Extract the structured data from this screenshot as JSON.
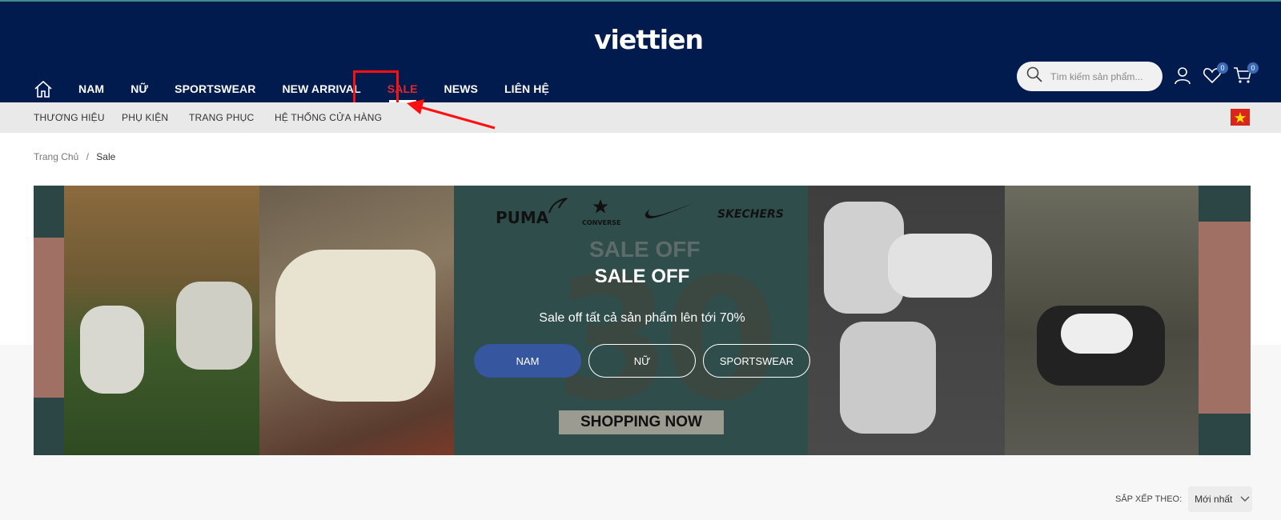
{
  "brand": {
    "logo_text": "viettien"
  },
  "nav": {
    "items": [
      {
        "label": "NAM"
      },
      {
        "label": "NỮ"
      },
      {
        "label": "SPORTSWEAR"
      },
      {
        "label": "NEW ARRIVAL"
      },
      {
        "label": "SALE",
        "active": true
      },
      {
        "label": "NEWS"
      },
      {
        "label": "LIÊN HỆ"
      }
    ]
  },
  "search": {
    "placeholder": "Tìm kiếm sản phẩm..."
  },
  "header_icons": {
    "wishlist_count": "0",
    "cart_count": "0"
  },
  "subnav": {
    "items": [
      {
        "label": "THƯƠNG HIỆU"
      },
      {
        "label": "PHỤ KIỆN"
      },
      {
        "label": "TRANG PHỤC"
      },
      {
        "label": "HỆ THỐNG CỬA HÀNG"
      }
    ]
  },
  "breadcrumb": {
    "home": "Trang Chủ",
    "separator": "/",
    "current": "Sale"
  },
  "banner": {
    "brands": [
      "PUMA",
      "CONVERSE",
      "SKECHERS"
    ],
    "big_number": "30",
    "percent": "%",
    "title_bg": "SALE OFF",
    "title": "SALE OFF",
    "subtitle": "Sale off tất cả sản phẩm lên tới 70%",
    "buttons": [
      {
        "label": "NAM"
      },
      {
        "label": "NỮ"
      },
      {
        "label": "SPORTSWEAR"
      }
    ],
    "cta": "SHOPPING NOW"
  },
  "sort": {
    "label": "SẮP XẾP THEO:",
    "selected": "Mới nhất"
  },
  "colors": {
    "header_bg": "#011b4e",
    "sale_red": "#e5262c",
    "accent_blue": "#3656a0",
    "annotation_red": "#ff1010"
  }
}
